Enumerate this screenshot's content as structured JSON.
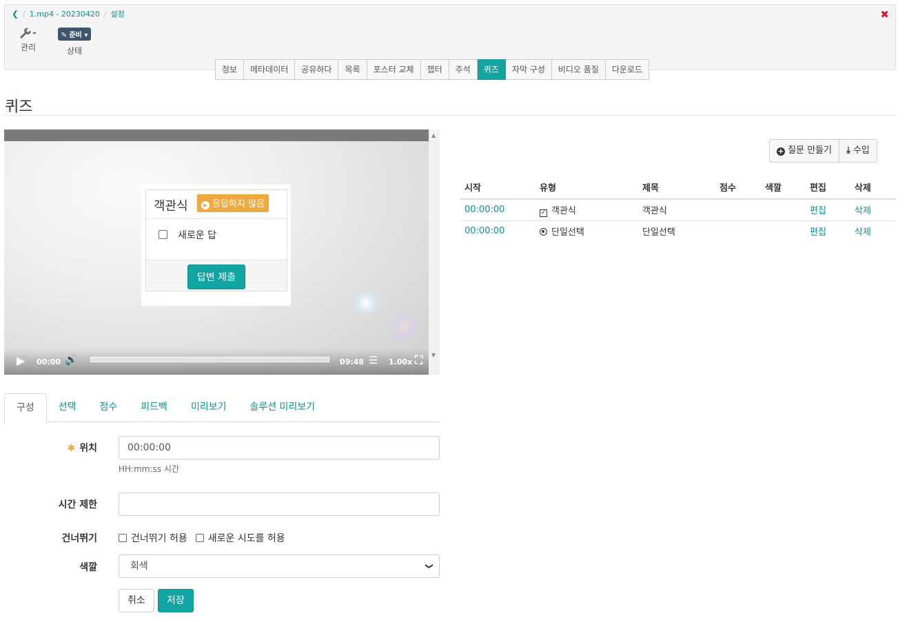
{
  "breadcrumb": {
    "file": "1.mp4 - 20230420",
    "current": "설정"
  },
  "toolbar": {
    "manage_label": "관리",
    "status_badge": "준비",
    "status_label": "상태"
  },
  "tabs": [
    "정보",
    "메타데이터",
    "공유하다",
    "목록",
    "포스터 교체",
    "챕터",
    "주석",
    "퀴즈",
    "자막 구성",
    "비디오 품질",
    "다운로드"
  ],
  "page_title": "퀴즈",
  "video": {
    "time_current": "00:00",
    "time_total": "09:48",
    "speed": "1.00x"
  },
  "quiz_overlay": {
    "title": "객관식",
    "badge": "응답하지 않음",
    "option": "새로운 답",
    "submit": "답변 제출"
  },
  "actions": {
    "create_question": "질문 만들기",
    "import": "수입"
  },
  "table": {
    "headers": [
      "시작",
      "유형",
      "제목",
      "점수",
      "색깔",
      "편집",
      "삭제"
    ],
    "rows": [
      {
        "start": "00:00:00",
        "type": "객관식",
        "title": "객관식",
        "score": "",
        "color": "",
        "edit": "편집",
        "delete": "삭제"
      },
      {
        "start": "00:00:00",
        "type": "단일선택",
        "title": "단일선택",
        "score": "",
        "color": "",
        "edit": "편집",
        "delete": "삭제"
      }
    ]
  },
  "form_tabs": [
    "구성",
    "선택",
    "점수",
    "피드백",
    "미리보기",
    "솔루션 미리보기"
  ],
  "form": {
    "position_label": "위치",
    "position_value": "00:00:00",
    "position_help": "HH:mm:ss 시간",
    "time_limit_label": "시간 제한",
    "time_limit_value": "",
    "skip_label": "건너뛰기",
    "skip_allow": "건너뛰기 허용",
    "retry_allow": "새로운 시도를 허용",
    "color_label": "색깔",
    "color_value": "회색",
    "cancel": "취소",
    "save": "저장"
  },
  "colors": {
    "accent": "#12a3a3",
    "link": "#0e8f90",
    "badge_orange": "#f0a941",
    "status_badge": "#3d566e",
    "close_red": "#d9142c",
    "required_star": "#f0a941"
  }
}
